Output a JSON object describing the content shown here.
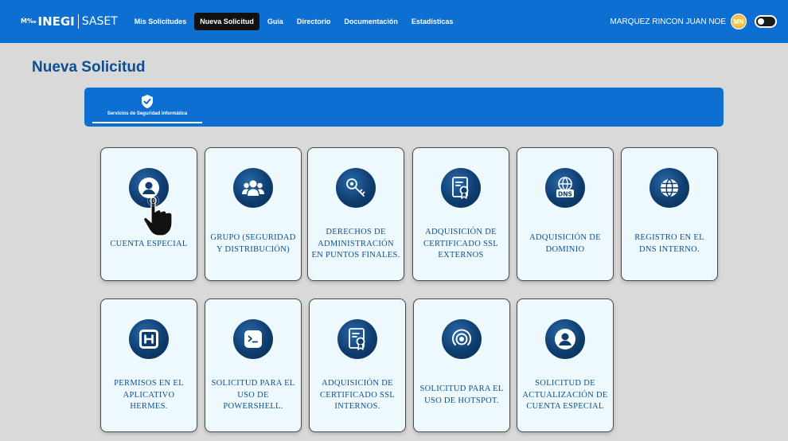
{
  "navbar": {
    "logo_icon": "Ṁ‰",
    "brand": "INEGI",
    "app": "SASET",
    "items": [
      {
        "label": "Mis Solicitudes",
        "active": false
      },
      {
        "label": "Nueva Solicitud",
        "active": true
      },
      {
        "label": "Guía",
        "active": false
      },
      {
        "label": "Directorio",
        "active": false
      },
      {
        "label": "Documentación",
        "active": false
      },
      {
        "label": "Estadísticas",
        "active": false
      }
    ],
    "user_name": "MARQUEZ RINCON JUAN NOE",
    "avatar_initials": "MN"
  },
  "page_title": "Nueva Solicitud",
  "category": {
    "label": "Servicios de Seguridad informática",
    "icon": "shield-check-icon"
  },
  "cards": [
    {
      "label": "CUENTA ESPECIAL",
      "icon": "user-circle-icon"
    },
    {
      "label": "GRUPO (SEGURIDAD Y DISTRIBUCIÓN)",
      "icon": "users-group-icon"
    },
    {
      "label": "DERECHOS DE ADMINISTRACIÓN EN PUNTOS FINALES.",
      "icon": "key-icon"
    },
    {
      "label": "ADQUISICIÓN DE CERTIFICADO SSL EXTERNOS",
      "icon": "certificate-icon"
    },
    {
      "label": "ADQUISICIÓN DE DOMINIO",
      "icon": "dns-icon"
    },
    {
      "label": "REGISTRO EN EL DNS INTERNO.",
      "icon": "globe-icon"
    },
    {
      "label": "PERMISOS EN EL APLICATIVO HERMES.",
      "icon": "hermes-h-icon"
    },
    {
      "label": "SOLICITUD PARA EL USO DE POWERSHELL.",
      "icon": "terminal-icon"
    },
    {
      "label": "ADQUISICIÓN DE CERTIFICADO SSL INTERNOS.",
      "icon": "certificate-icon"
    },
    {
      "label": "SOLICITUD PARA EL USO DE HOTSPOT.",
      "icon": "hotspot-icon"
    },
    {
      "label": "SOLICITUD DE ACTUALIZACIÓN DE CUENTA ESPECIAL",
      "icon": "user-circle-icon"
    }
  ],
  "colors": {
    "navbar": "#0d6fd1",
    "title": "#0b4e93",
    "card_bg": "#eef9fd",
    "icon_bg": "#0e3d6f",
    "page_bg": "#d9d9d9"
  }
}
